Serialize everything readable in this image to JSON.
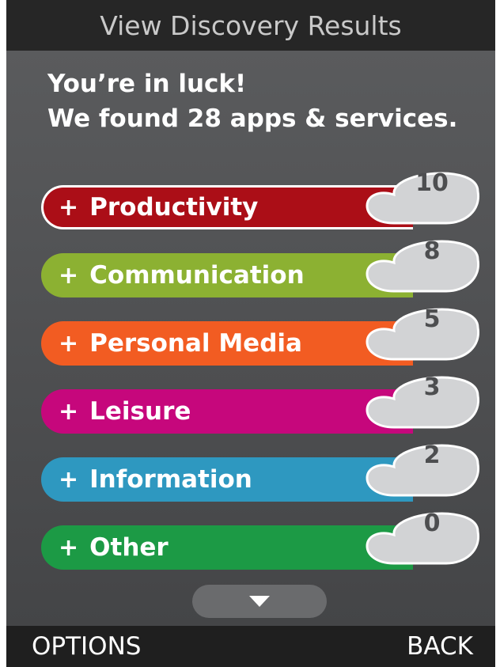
{
  "header": {
    "title": "View Discovery Results"
  },
  "message": {
    "line1": "You’re in luck!",
    "line2": "We found 28 apps & services."
  },
  "categories": [
    {
      "plus": "+",
      "label": "Productivity",
      "count": "10",
      "color": "#ab0e17",
      "selected": true
    },
    {
      "plus": "+",
      "label": "Communication",
      "count": "8",
      "color": "#8cb132"
    },
    {
      "plus": "+",
      "label": "Personal Media",
      "count": "5",
      "color": "#f25c22"
    },
    {
      "plus": "+",
      "label": "Leisure",
      "count": "3",
      "color": "#c6077c"
    },
    {
      "plus": "+",
      "label": "Information",
      "count": "2",
      "color": "#2e98c0"
    },
    {
      "plus": "+",
      "label": "Other",
      "count": "0",
      "color": "#1c9a45"
    }
  ],
  "scroll": {
    "icon": "down-arrow-icon"
  },
  "softkeys": {
    "left": "OPTIONS",
    "right": "BACK"
  }
}
